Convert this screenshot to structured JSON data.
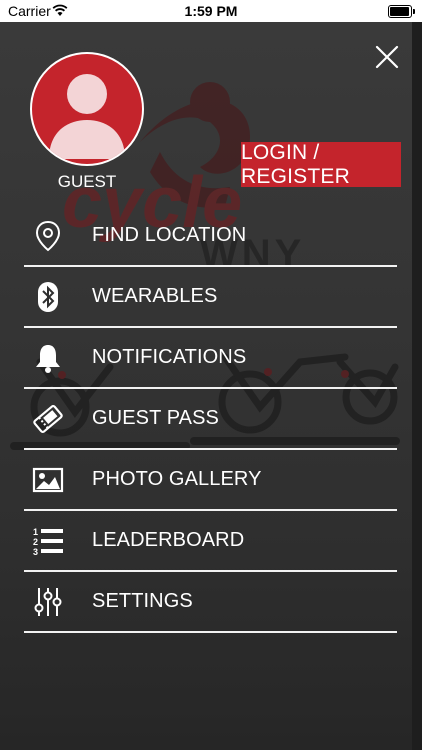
{
  "status_bar": {
    "carrier": "Carrier",
    "time": "1:59 PM"
  },
  "profile": {
    "name": "GUEST",
    "avatar_color": "#c4242c"
  },
  "login_button": {
    "label": "LOGIN / REGISTER",
    "color": "#c4242c"
  },
  "background_logo": {
    "brand": "cycle",
    "sub": "WNY"
  },
  "menu": {
    "items": [
      {
        "label": "FIND LOCATION",
        "icon": "location-pin-icon"
      },
      {
        "label": "WEARABLES",
        "icon": "bluetooth-icon"
      },
      {
        "label": "NOTIFICATIONS",
        "icon": "bell-icon"
      },
      {
        "label": "GUEST PASS",
        "icon": "ticket-icon"
      },
      {
        "label": "PHOTO GALLERY",
        "icon": "photo-icon"
      },
      {
        "label": "LEADERBOARD",
        "icon": "numbered-list-icon"
      },
      {
        "label": "SETTINGS",
        "icon": "sliders-icon"
      }
    ]
  }
}
